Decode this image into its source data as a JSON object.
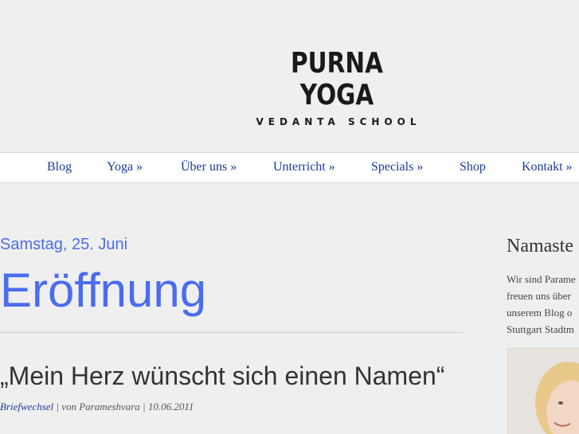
{
  "header": {
    "logo_title": "PURNA YOGA",
    "logo_subtitle": "VEDANTA SCHOOL"
  },
  "nav": {
    "items": [
      {
        "label": "Blog"
      },
      {
        "label": "Yoga »"
      },
      {
        "label": "Über uns »"
      },
      {
        "label": "Unterricht »"
      },
      {
        "label": "Specials »"
      },
      {
        "label": "Shop"
      },
      {
        "label": "Kontakt »"
      }
    ]
  },
  "main": {
    "date": "Samstag, 25. Juni",
    "title": "Eröffnung",
    "post": {
      "title": "„Mein Herz wünscht sich einen Namen“",
      "category": "Briefwechsel",
      "sep1": " | von ",
      "author": "Parameshvara",
      "sep2": " | ",
      "date": "10.06.2011"
    }
  },
  "sidebar": {
    "title": "Namaste",
    "lines": [
      "Wir sind Parame",
      "freuen uns über",
      "unserem Blog o",
      "Stuttgart Stadtm"
    ]
  },
  "colors": {
    "link": "#1b3a9a",
    "accent": "#4a6cf0",
    "background": "#efefef"
  }
}
